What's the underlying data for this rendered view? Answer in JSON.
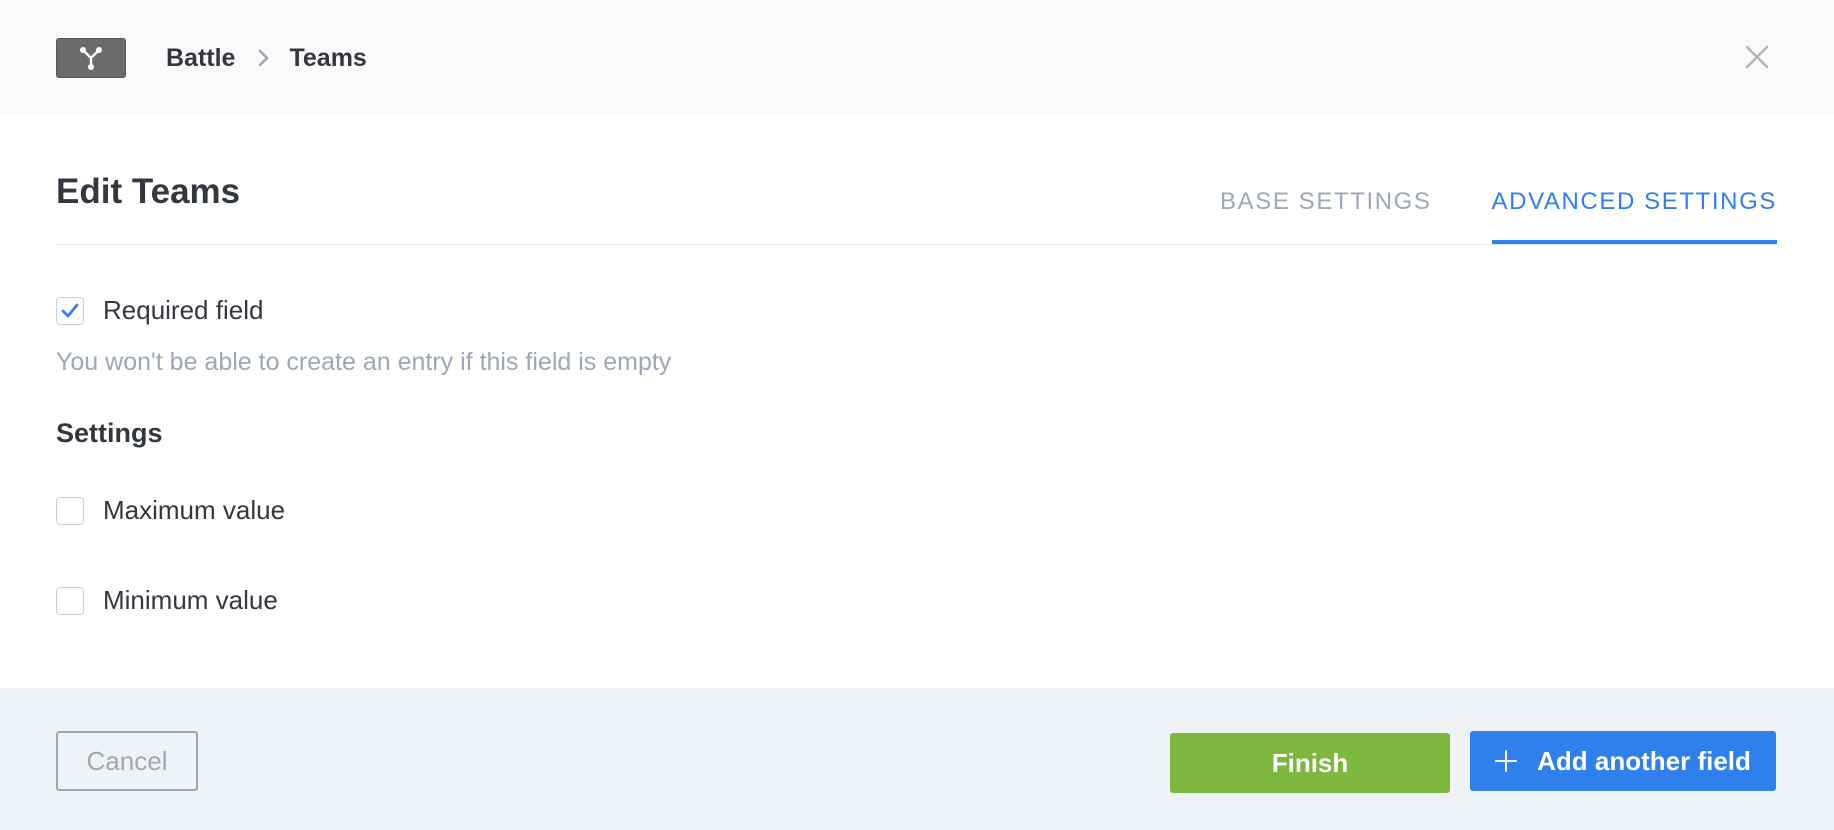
{
  "header": {
    "logo_icon": "relation-icon",
    "breadcrumb": {
      "parent": "Battle",
      "current": "Teams",
      "separator_icon": "chevron-right-icon"
    },
    "close_icon": "close-icon"
  },
  "modal": {
    "title": "Edit Teams",
    "tabs": [
      {
        "label": "BASE SETTINGS",
        "active": false
      },
      {
        "label": "ADVANCED SETTINGS",
        "active": true
      }
    ]
  },
  "advanced": {
    "required": {
      "label": "Required field",
      "checked": true,
      "hint": "You won't be able to create an entry if this field is empty"
    },
    "settings_title": "Settings",
    "options": [
      {
        "label": "Maximum value",
        "checked": false
      },
      {
        "label": "Minimum value",
        "checked": false
      }
    ]
  },
  "footer": {
    "cancel_label": "Cancel",
    "finish_label": "Finish",
    "add_label": "Add another field",
    "add_icon": "plus-icon"
  },
  "colors": {
    "accent": "#2f80ed",
    "success": "#7eb73d",
    "muted": "#9ea7b8",
    "text": "#333740"
  }
}
